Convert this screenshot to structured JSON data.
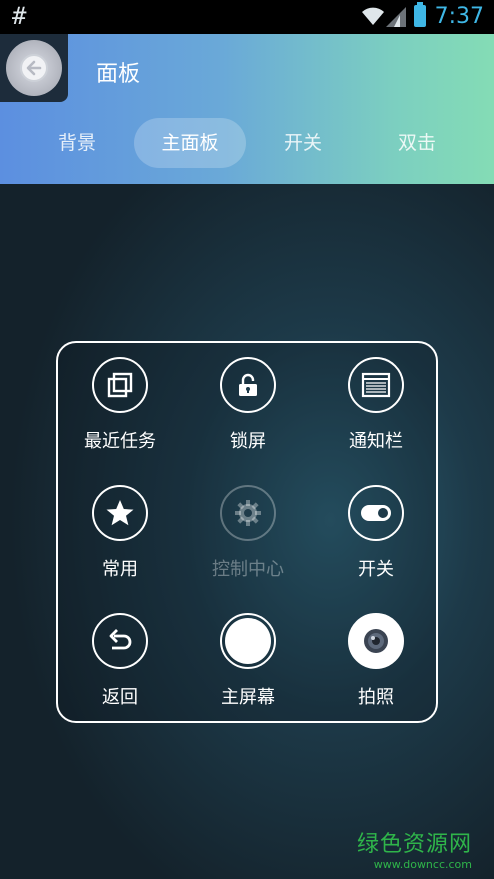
{
  "status_bar": {
    "left_glyph": "#",
    "time": "7:37",
    "icons": [
      "wifi-icon",
      "signal-icon",
      "battery-icon"
    ]
  },
  "header": {
    "title": "面板",
    "back_icon": "back-arrow-icon",
    "tabs": [
      {
        "label": "背景",
        "active": false
      },
      {
        "label": "主面板",
        "active": true
      },
      {
        "label": "开关",
        "active": false
      },
      {
        "label": "双击",
        "active": false
      }
    ]
  },
  "panel": {
    "items": [
      {
        "label": "最近任务",
        "icon": "recent-tasks-icon",
        "enabled": true
      },
      {
        "label": "锁屏",
        "icon": "lock-icon",
        "enabled": true
      },
      {
        "label": "通知栏",
        "icon": "notification-bar-icon",
        "enabled": true
      },
      {
        "label": "常用",
        "icon": "star-icon",
        "enabled": true
      },
      {
        "label": "控制中心",
        "icon": "gear-icon",
        "enabled": false
      },
      {
        "label": "开关",
        "icon": "toggle-icon",
        "enabled": true
      },
      {
        "label": "返回",
        "icon": "undo-arrow-icon",
        "enabled": true
      },
      {
        "label": "主屏幕",
        "icon": "home-circle-icon",
        "enabled": true
      },
      {
        "label": "拍照",
        "icon": "camera-icon",
        "enabled": true
      }
    ]
  },
  "watermark": {
    "title": "绿色资源网",
    "url": "www.downcc.com"
  },
  "colors": {
    "accent_blue": "#3fb7e6",
    "header_start": "#5c8fe0",
    "header_end": "#84dcb5",
    "watermark_green": "#2fb54a"
  }
}
